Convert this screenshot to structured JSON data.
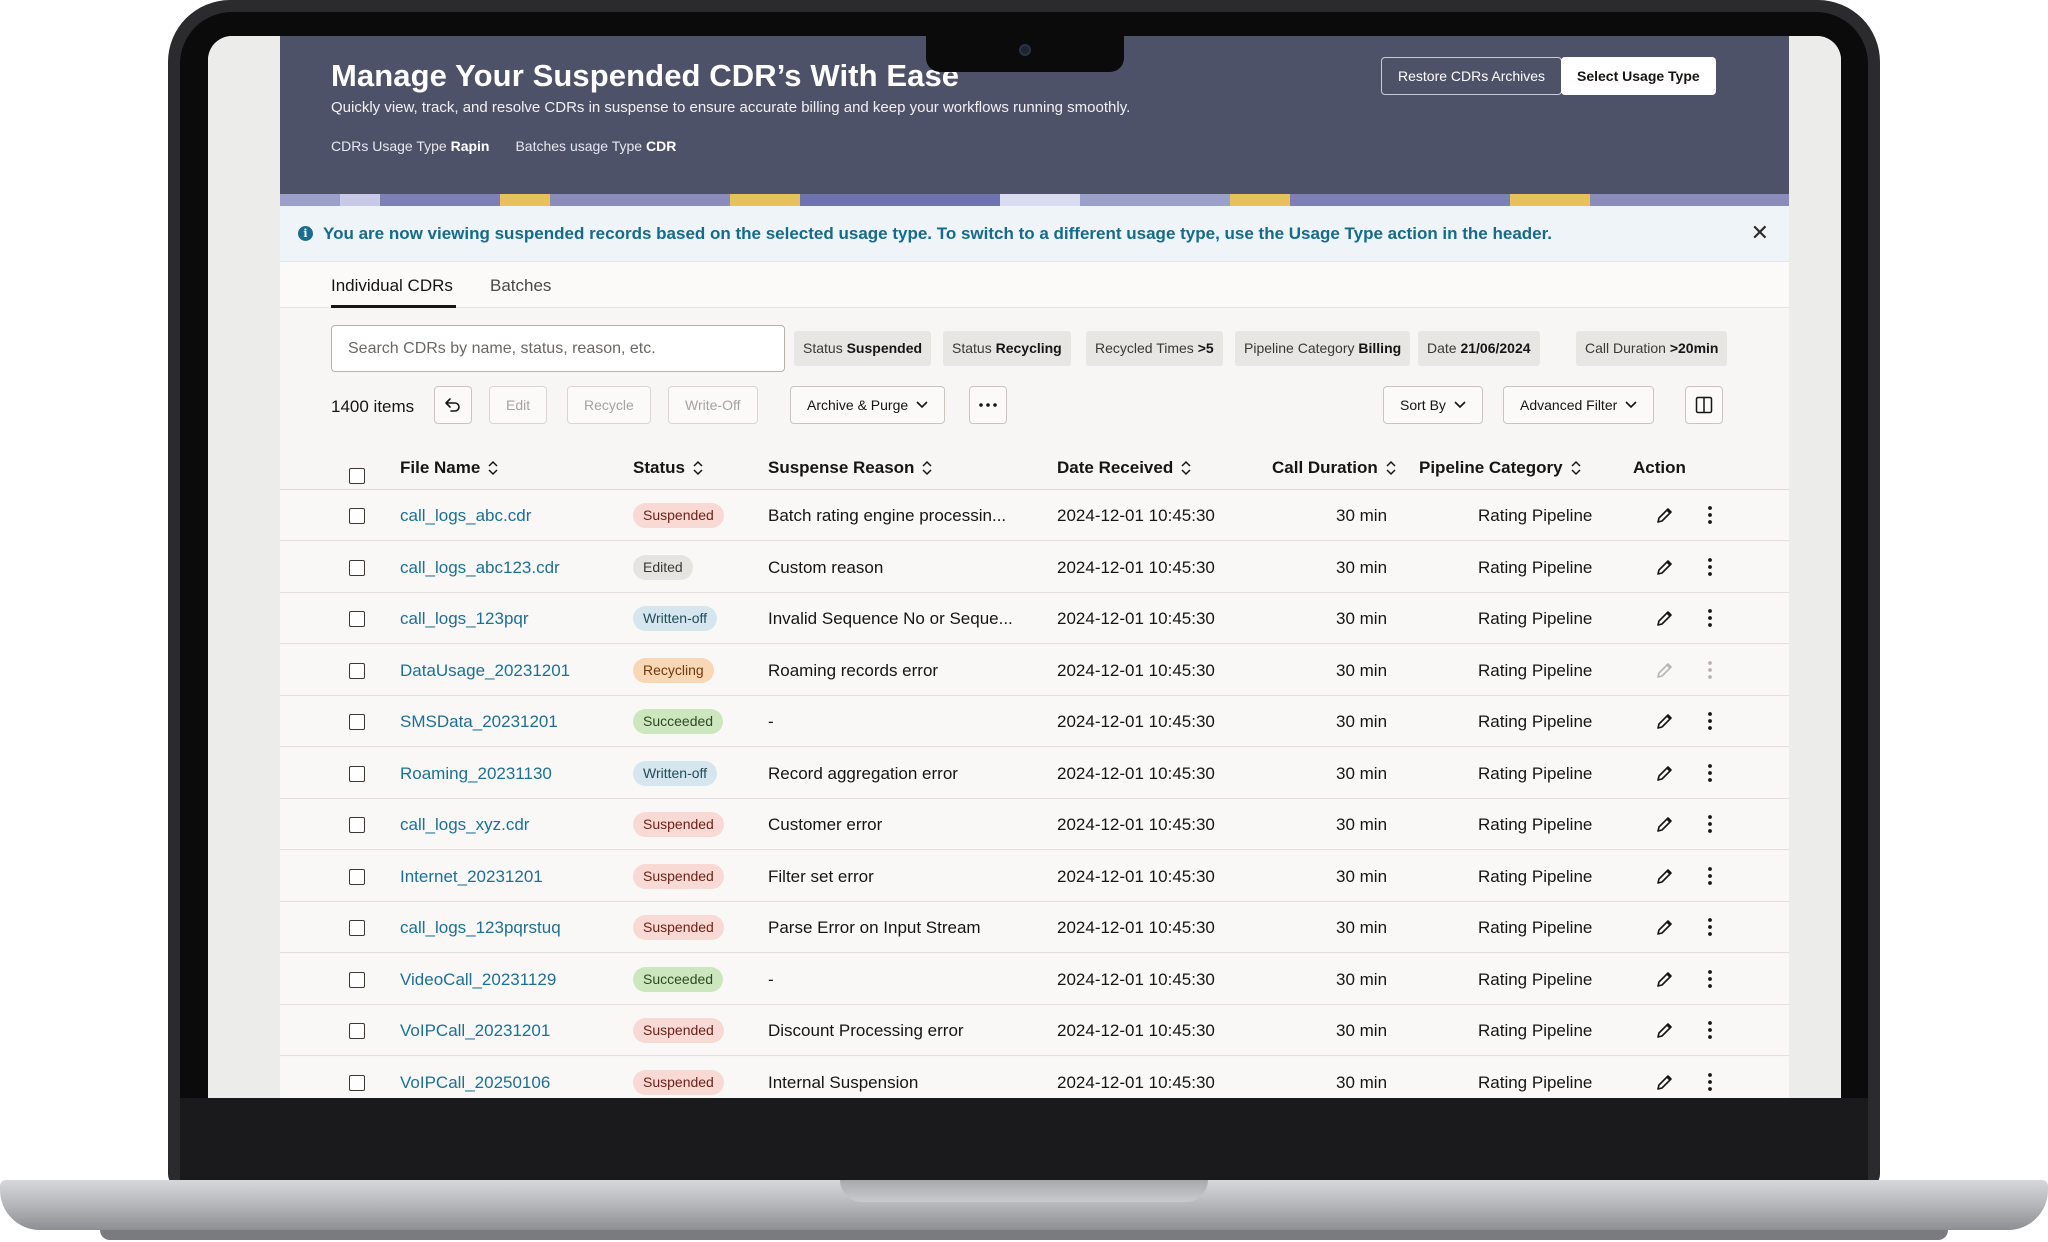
{
  "header": {
    "title": "Manage Your Suspended CDR’s With Ease",
    "subtitle": "Quickly view, track, and resolve CDRs in suspense to ensure accurate billing and keep your workflows running smoothly.",
    "cdr_usage_label": "CDRs Usage Type",
    "cdr_usage_value": "Rapin",
    "batch_usage_label": "Batches usage Type",
    "batch_usage_value": "CDR",
    "restore_button": "Restore CDRs Archives",
    "select_usage_button": "Select Usage Type"
  },
  "banner": {
    "text": "You are now viewing suspended records based on the selected usage type. To switch to a different usage type, use the Usage Type action in the header.",
    "close": "✕"
  },
  "tabs": [
    "Individual CDRs",
    "Batches"
  ],
  "search": {
    "placeholder": "Search CDRs by name, status, reason, etc."
  },
  "filters": [
    {
      "label": "Status",
      "value": "Suspended"
    },
    {
      "label": "Status",
      "value": "Recycling"
    },
    {
      "label": "Recycled Times",
      "value": ">5"
    },
    {
      "label": "Pipeline Category",
      "value": "Billing"
    },
    {
      "label": "Date",
      "value": "21/06/2024"
    },
    {
      "label": "Call Duration",
      "value": ">20min"
    }
  ],
  "toolbar": {
    "count": "1400 items",
    "edit": "Edit",
    "recycle": "Recycle",
    "write_off": "Write-Off",
    "archive": "Archive & Purge",
    "sort_by": "Sort By",
    "advanced_filter": "Advanced Filter"
  },
  "columns": [
    "File Name",
    "Status",
    "Suspense Reason",
    "Date Received",
    "Call Duration",
    "Pipeline Category",
    "Action"
  ],
  "status_colors": {
    "Suspended": {
      "bg": "#f8d9d4",
      "fg": "#6d2119"
    },
    "Edited": {
      "bg": "#e6e4e0",
      "fg": "#3a3835"
    },
    "Written-off": {
      "bg": "#d6e6ee",
      "fg": "#254a5a"
    },
    "Recycling": {
      "bg": "#f9d7b5",
      "fg": "#6b3a0d"
    },
    "Succeeded": {
      "bg": "#cce7bd",
      "fg": "#2c4a1f"
    }
  },
  "rows": [
    {
      "file": "call_logs_abc.cdr",
      "status": "Suspended",
      "reason": "Batch rating engine processin...",
      "date": "2024-12-01 10:45:30",
      "duration": "30 min",
      "pipeline": "Rating Pipeline",
      "actions_disabled": false
    },
    {
      "file": "call_logs_abc123.cdr",
      "status": "Edited",
      "reason": "Custom reason",
      "date": "2024-12-01 10:45:30",
      "duration": "30 min",
      "pipeline": "Rating Pipeline",
      "actions_disabled": false
    },
    {
      "file": "call_logs_123pqr",
      "status": "Written-off",
      "reason": "Invalid Sequence No or Seque...",
      "date": "2024-12-01 10:45:30",
      "duration": "30 min",
      "pipeline": "Rating Pipeline",
      "actions_disabled": false
    },
    {
      "file": "DataUsage_20231201",
      "status": "Recycling",
      "reason": "Roaming records error",
      "date": "2024-12-01 10:45:30",
      "duration": "30 min",
      "pipeline": "Rating Pipeline",
      "actions_disabled": true
    },
    {
      "file": "SMSData_20231201",
      "status": "Succeeded",
      "reason": "-",
      "date": "2024-12-01 10:45:30",
      "duration": "30 min",
      "pipeline": "Rating Pipeline",
      "actions_disabled": false
    },
    {
      "file": "Roaming_20231130",
      "status": "Written-off",
      "reason": "Record aggregation error",
      "date": "2024-12-01 10:45:30",
      "duration": "30 min",
      "pipeline": "Rating Pipeline",
      "actions_disabled": false
    },
    {
      "file": "call_logs_xyz.cdr",
      "status": "Suspended",
      "reason": "Customer error",
      "date": "2024-12-01 10:45:30",
      "duration": "30 min",
      "pipeline": "Rating Pipeline",
      "actions_disabled": false
    },
    {
      "file": "Internet_20231201",
      "status": "Suspended",
      "reason": "Filter set error",
      "date": "2024-12-01 10:45:30",
      "duration": "30 min",
      "pipeline": "Rating Pipeline",
      "actions_disabled": false
    },
    {
      "file": "call_logs_123pqrstuq",
      "status": "Suspended",
      "reason": "Parse Error on Input Stream",
      "date": "2024-12-01 10:45:30",
      "duration": "30 min",
      "pipeline": "Rating Pipeline",
      "actions_disabled": false
    },
    {
      "file": "VideoCall_20231129",
      "status": "Succeeded",
      "reason": "-",
      "date": "2024-12-01 10:45:30",
      "duration": "30 min",
      "pipeline": "Rating Pipeline",
      "actions_disabled": false
    },
    {
      "file": "VoIPCall_20231201",
      "status": "Suspended",
      "reason": "Discount Processing error",
      "date": "2024-12-01 10:45:30",
      "duration": "30 min",
      "pipeline": "Rating Pipeline",
      "actions_disabled": false
    },
    {
      "file": "VoIPCall_20250106",
      "status": "Suspended",
      "reason": "Internal Suspension",
      "date": "2024-12-01 10:45:30",
      "duration": "30 min",
      "pipeline": "Rating Pipeline",
      "actions_disabled": false
    }
  ]
}
